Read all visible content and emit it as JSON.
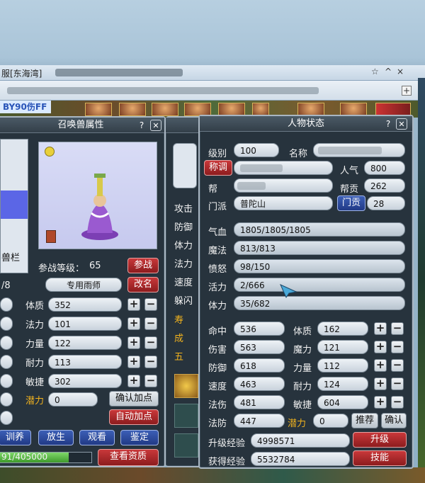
{
  "topbar": {
    "title": "服[东海湾]",
    "controls": [
      "☆",
      "^",
      "×"
    ]
  },
  "server_tag": "BY90伤FF",
  "pet_panel": {
    "title": "召唤兽属性",
    "help": "?",
    "close": "✕",
    "sidebar_label": "兽栏",
    "sidebar_count": "/8",
    "battle_level_label": "参战等级：",
    "battle_level": "65",
    "battle_button": "参战",
    "pet_name": "专用雨师",
    "rename_button": "改名",
    "stats": [
      {
        "label": "体质",
        "value": "352"
      },
      {
        "label": "法力",
        "value": "101"
      },
      {
        "label": "力量",
        "value": "122"
      },
      {
        "label": "耐力",
        "value": "113"
      },
      {
        "label": "敏捷",
        "value": "302"
      }
    ],
    "potential_label": "潜力",
    "potential_value": "0",
    "confirm_add": "确认加点",
    "auto_add": "自动加点",
    "bottom_buttons": [
      "训养",
      "放生",
      "观看",
      "鉴定"
    ],
    "exp_text": "91/405000",
    "exp_ratio": 0.75,
    "view_aptitude": "查看资质"
  },
  "middle_labels": [
    "攻击",
    "防御",
    "体力",
    "法力",
    "速度",
    "躲闪"
  ],
  "middle_gold": [
    "寿",
    "成",
    "五"
  ],
  "char_panel": {
    "title": "人物状态",
    "help": "?",
    "close": "✕",
    "level_label": "级别",
    "level_value": "100",
    "name_label": "名称",
    "title_button": "称调",
    "popularity_label": "人气",
    "popularity_value": "800",
    "gang_label": "帮",
    "gang_contrib_label": "帮贡",
    "gang_contrib_value": "262",
    "school_label": "门派",
    "school_value": "普陀山",
    "school_contrib_button": "门贡",
    "school_contrib_value": "28",
    "bars": [
      {
        "label": "气血",
        "value": "1805/1805/1805"
      },
      {
        "label": "魔法",
        "value": "813/813"
      },
      {
        "label": "愤怒",
        "value": "98/150"
      },
      {
        "label": "活力",
        "value": "2/666"
      },
      {
        "label": "体力",
        "value": "35/682"
      }
    ],
    "attrs_left": [
      {
        "label": "命中",
        "value": "536"
      },
      {
        "label": "伤害",
        "value": "563"
      },
      {
        "label": "防御",
        "value": "618"
      },
      {
        "label": "速度",
        "value": "463"
      },
      {
        "label": "法伤",
        "value": "481"
      },
      {
        "label": "法防",
        "value": "447"
      }
    ],
    "attrs_right": [
      {
        "label": "体质",
        "value": "162"
      },
      {
        "label": "魔力",
        "value": "121"
      },
      {
        "label": "力量",
        "value": "112"
      },
      {
        "label": "耐力",
        "value": "124"
      },
      {
        "label": "敏捷",
        "value": "604"
      }
    ],
    "potential_label": "潜力",
    "potential_value": "0",
    "recommend_button": "推荐",
    "confirm_button": "确认",
    "upgrade_exp_label": "升级经验",
    "upgrade_exp_value": "4998571",
    "upgrade_button": "升级",
    "gain_exp_label": "获得经验",
    "gain_exp_value": "5532784",
    "skill_button": "技能"
  }
}
